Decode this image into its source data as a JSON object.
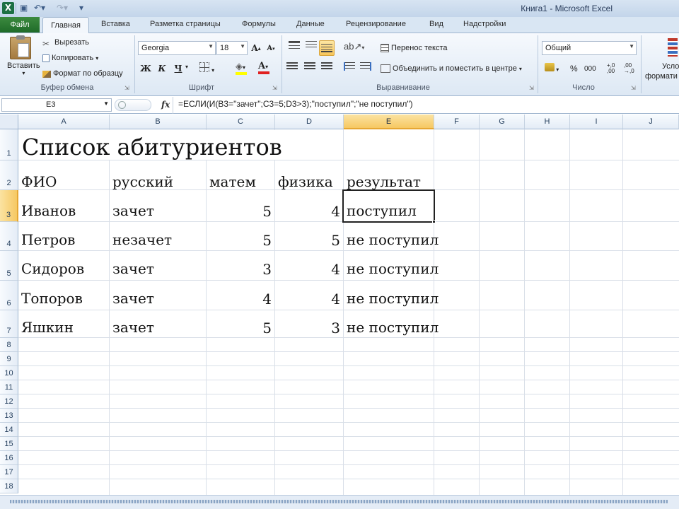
{
  "window": {
    "title": "Книга1 - Microsoft Excel"
  },
  "tabs": [
    "Файл",
    "Главная",
    "Вставка",
    "Разметка страницы",
    "Формулы",
    "Данные",
    "Рецензирование",
    "Вид",
    "Надстройки"
  ],
  "ribbon": {
    "clipboard": {
      "paste": "Вставить",
      "cut": "Вырезать",
      "copy": "Копировать",
      "format_painter": "Формат по образцу",
      "group": "Буфер обмена"
    },
    "font": {
      "name": "Georgia",
      "size": "18",
      "bold": "Ж",
      "italic": "К",
      "underline": "Ч",
      "grow": "A",
      "shrink": "A",
      "color": "A",
      "group": "Шрифт"
    },
    "alignment": {
      "wrap": "Перенос текста",
      "merge": "Объединить и поместить в центре",
      "group": "Выравнивание"
    },
    "number": {
      "format": "Общий",
      "percent": "%",
      "thousands": "000",
      "inc": "+,0 ,00",
      "dec": ",00 →,0",
      "group": "Число"
    },
    "styles": {
      "cond": "Усло",
      "format": "формати"
    }
  },
  "formula_bar": {
    "name_box": "E3",
    "fx": "fx",
    "formula": "=ЕСЛИ(И(B3=\"зачет\";C3=5;D3>3);\"поступил\";\"не поступил\")"
  },
  "columns": [
    "A",
    "B",
    "C",
    "D",
    "E",
    "F",
    "G",
    "H",
    "I",
    "J"
  ],
  "rows": [
    "1",
    "2",
    "3",
    "4",
    "5",
    "6",
    "7",
    "8",
    "9",
    "10",
    "11",
    "12",
    "13",
    "14",
    "15",
    "16",
    "17",
    "18"
  ],
  "sheet": {
    "title": "Список абитуриентов",
    "headers": [
      "ФИО",
      "русский",
      "матем",
      "физика",
      "результат"
    ],
    "data": [
      [
        "Иванов",
        "зачет",
        "5",
        "4",
        "поступил"
      ],
      [
        "Петров",
        "незачет",
        "5",
        "5",
        "не поступил"
      ],
      [
        "Сидоров",
        "зачет",
        "3",
        "4",
        "не поступил"
      ],
      [
        "Топоров",
        "зачет",
        "4",
        "4",
        "не поступил"
      ],
      [
        "Яшкин",
        "зачет",
        "5",
        "3",
        "не поступил"
      ]
    ]
  }
}
